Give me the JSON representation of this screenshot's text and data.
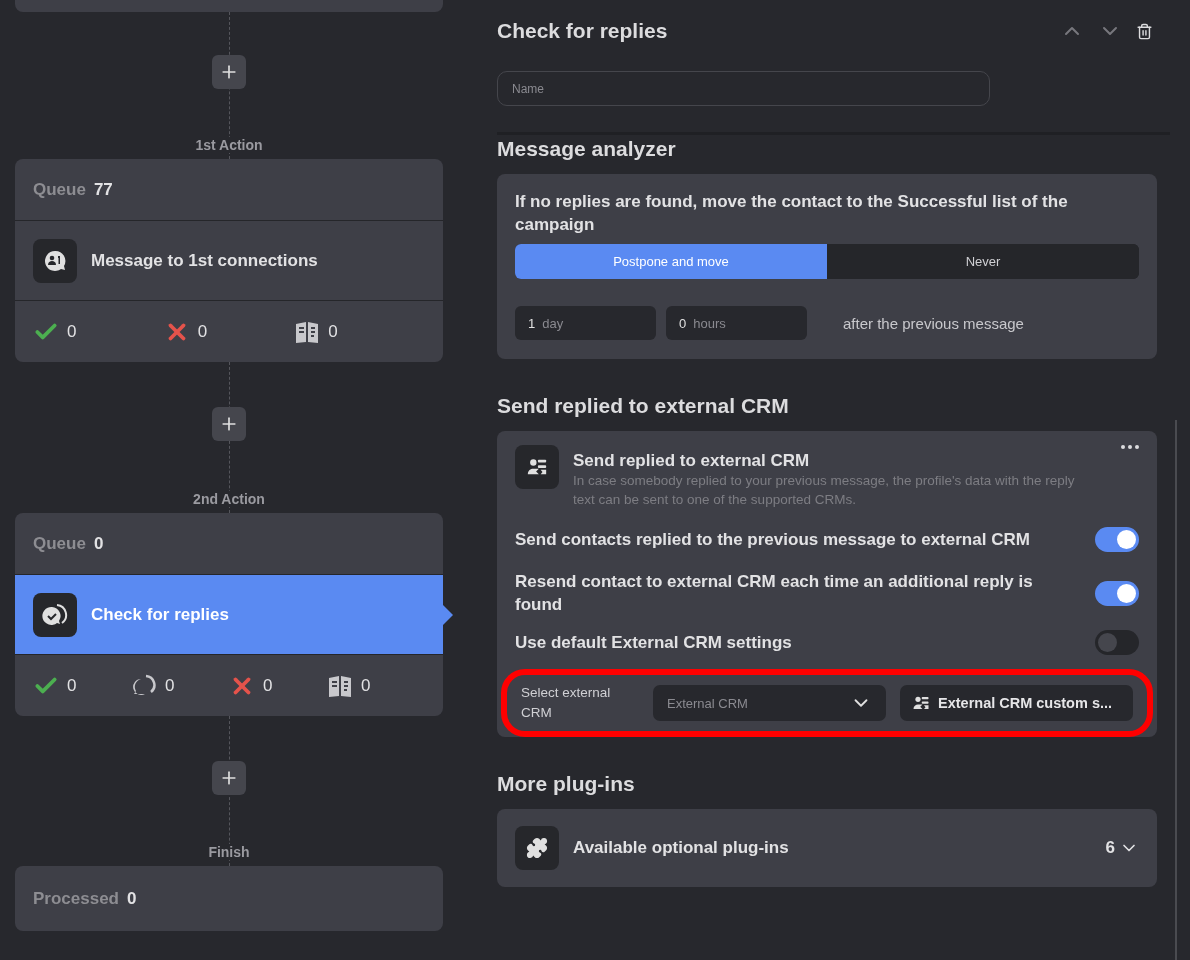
{
  "flow": [
    {
      "label": "1st Action",
      "queue_label": "Queue",
      "queue": "77",
      "action": {
        "title": "Message to 1st connections",
        "kind": "message",
        "selected": false
      },
      "stats": [
        {
          "kind": "success",
          "value": "0"
        },
        {
          "kind": "failed",
          "value": "0"
        },
        {
          "kind": "skipped",
          "value": "0"
        }
      ]
    },
    {
      "label": "2nd Action",
      "queue_label": "Queue",
      "queue": "0",
      "action": {
        "title": "Check for replies",
        "kind": "reply",
        "selected": true
      },
      "stats": [
        {
          "kind": "success",
          "value": "0"
        },
        {
          "kind": "replied",
          "value": "0"
        },
        {
          "kind": "failed",
          "value": "0"
        },
        {
          "kind": "skipped",
          "value": "0"
        }
      ]
    }
  ],
  "finish": {
    "label": "Finish",
    "processed_label": "Processed",
    "value": "0"
  },
  "panel": {
    "title": "Check for replies",
    "name_field": {
      "placeholder": "Name"
    },
    "analyzer": {
      "heading": "Message analyzer",
      "question": "If no replies are found, move the contact to the Successful list of the campaign",
      "options": [
        {
          "label": "Postpone and move",
          "selected": true
        },
        {
          "label": "Never",
          "selected": false
        }
      ],
      "delays": [
        {
          "value": "1",
          "unit": "day"
        },
        {
          "value": "0",
          "unit": "hours"
        }
      ],
      "suffix": "after the previous message"
    },
    "crm": {
      "heading": "Send replied to external CRM",
      "plugin_title": "Send replied to external CRM",
      "description": "In case somebody replied to your previous message, the profile's data with the reply text can be sent to one of the supported CRMs.",
      "toggles": [
        {
          "label": "Send contacts replied to the previous message to external CRM",
          "on": true
        },
        {
          "label": "Resend contact to external CRM each time an additional reply is found",
          "on": true
        },
        {
          "label": "Use default External CRM settings",
          "on": false
        }
      ],
      "select": {
        "label": "Select external CRM",
        "placeholder": "External CRM",
        "button": "External CRM custom s...",
        "highlighted": true
      }
    },
    "more": {
      "heading": "More plug-ins",
      "title": "Available optional plug-ins",
      "count": "6"
    }
  }
}
